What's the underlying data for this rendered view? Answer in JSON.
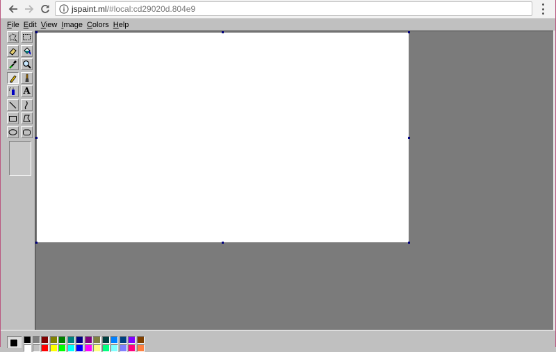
{
  "browser": {
    "url_host": "jspaint.ml",
    "url_rest": "/#local:cd29020d.804e9"
  },
  "menu": [
    {
      "underline": "F",
      "rest": "ile"
    },
    {
      "underline": "E",
      "rest": "dit"
    },
    {
      "underline": "V",
      "rest": "iew"
    },
    {
      "underline": "I",
      "rest": "mage"
    },
    {
      "underline": "C",
      "rest": "olors"
    },
    {
      "underline": "H",
      "rest": "elp"
    }
  ],
  "tools": [
    {
      "name": "free-form-select",
      "selected": false
    },
    {
      "name": "select",
      "selected": false
    },
    {
      "name": "eraser",
      "selected": false
    },
    {
      "name": "fill-with-color",
      "selected": false
    },
    {
      "name": "pick-color",
      "selected": false
    },
    {
      "name": "magnifier",
      "selected": false
    },
    {
      "name": "pencil",
      "selected": true
    },
    {
      "name": "brush",
      "selected": false
    },
    {
      "name": "airbrush",
      "selected": false
    },
    {
      "name": "text",
      "selected": false
    },
    {
      "name": "line",
      "selected": false
    },
    {
      "name": "curve",
      "selected": false
    },
    {
      "name": "rectangle",
      "selected": false
    },
    {
      "name": "polygon",
      "selected": false
    },
    {
      "name": "ellipse",
      "selected": false
    },
    {
      "name": "rounded-rectangle",
      "selected": false
    }
  ],
  "text_tool_glyph": "A",
  "colors": {
    "foreground": "#000000",
    "background": "#ffffff",
    "palette_top": [
      "#000000",
      "#808080",
      "#800000",
      "#808000",
      "#008000",
      "#008080",
      "#000080",
      "#800080",
      "#808040",
      "#004040",
      "#0080ff",
      "#004080",
      "#8000ff",
      "#804000"
    ],
    "palette_bottom": [
      "#ffffff",
      "#c0c0c0",
      "#ff0000",
      "#ffff00",
      "#00ff00",
      "#00ffff",
      "#0000ff",
      "#ff00ff",
      "#ffff80",
      "#00ff80",
      "#80ffff",
      "#8080ff",
      "#ff0080",
      "#ff8040"
    ]
  }
}
